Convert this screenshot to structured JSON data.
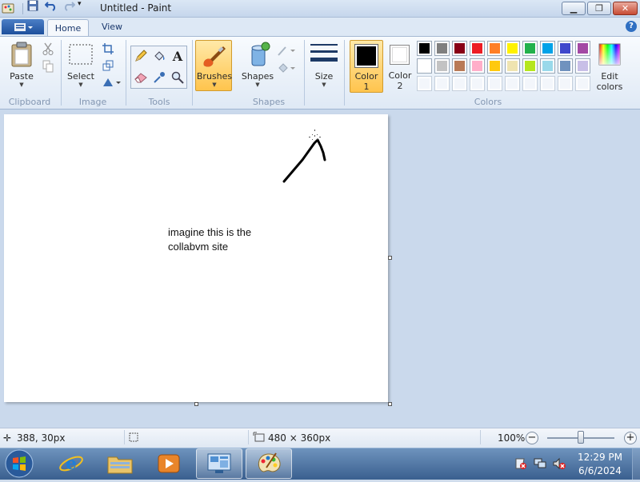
{
  "window": {
    "title": "Untitled - Paint"
  },
  "tabs": {
    "home": "Home",
    "view": "View"
  },
  "ribbon": {
    "clipboard": {
      "paste": "Paste",
      "label": "Clipboard"
    },
    "image": {
      "select": "Select",
      "label": "Image"
    },
    "tools": {
      "label": "Tools"
    },
    "brushes": {
      "label": "Brushes"
    },
    "shapes": {
      "shapes": "Shapes",
      "label": "Shapes"
    },
    "size": {
      "label": "Size"
    },
    "color1": {
      "line1": "Color",
      "line2": "1",
      "value": "#000000"
    },
    "color2": {
      "line1": "Color",
      "line2": "2",
      "value": "#ffffff"
    },
    "colors": {
      "label": "Colors",
      "edit_line1": "Edit",
      "edit_line2": "colors",
      "palette": [
        "#000000",
        "#7f7f7f",
        "#880015",
        "#ed1c24",
        "#ff7f27",
        "#fff200",
        "#22b14c",
        "#00a2e8",
        "#3f48cc",
        "#a349a4",
        "#ffffff",
        "#c3c3c3",
        "#b97a57",
        "#ffaec9",
        "#ffc90e",
        "#efe4b0",
        "#b5e61d",
        "#99d9ea",
        "#7092be",
        "#c8bfe7"
      ]
    }
  },
  "canvas": {
    "text": "imagine this is the\ncollabvm site"
  },
  "status": {
    "cursor_pos": "388, 30px",
    "canvas_size": "480 × 360px",
    "zoom": "100%",
    "zoom_level": 1.0
  },
  "taskbar": {
    "time": "12:29 PM",
    "date": "6/6/2024"
  }
}
